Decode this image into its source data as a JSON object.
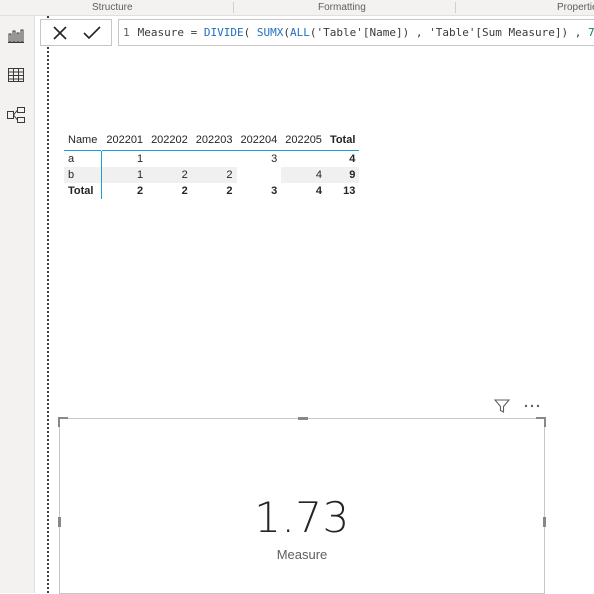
{
  "ribbon": {
    "groups": [
      "Structure",
      "Formatting",
      "Properties"
    ]
  },
  "rail": {
    "items": [
      {
        "icon": "report-view-icon"
      },
      {
        "icon": "data-view-icon"
      },
      {
        "icon": "model-view-icon"
      }
    ]
  },
  "formula_bar": {
    "cancel_icon": "close-icon",
    "commit_icon": "checkmark-icon",
    "line_number": "1",
    "parts": [
      {
        "text": "Measure",
        "kind": "plain"
      },
      {
        "text": " = ",
        "kind": "plain"
      },
      {
        "text": "DIVIDE",
        "kind": "kw"
      },
      {
        "text": "( ",
        "kind": "plain"
      },
      {
        "text": "SUMX",
        "kind": "kw"
      },
      {
        "text": "(",
        "kind": "plain"
      },
      {
        "text": "ALL",
        "kind": "kw"
      },
      {
        "text": "('Table'[Name]) , ",
        "kind": "plain"
      },
      {
        "text": "'Table'[Sum Measure]",
        "kind": "plain"
      },
      {
        "text": ") , ",
        "kind": "plain"
      },
      {
        "text": "7",
        "kind": "num"
      }
    ]
  },
  "matrix": {
    "headers": [
      "Name",
      "202201",
      "202202",
      "202203",
      "202204",
      "202205",
      "Total"
    ],
    "rows": [
      {
        "name": "a",
        "cells": [
          "1",
          "",
          "",
          "3",
          "",
          "4"
        ]
      },
      {
        "name": "b",
        "cells": [
          "1",
          "2",
          "2",
          "",
          "4",
          "9"
        ]
      }
    ],
    "grand_total": {
      "name": "Total",
      "cells": [
        "2",
        "2",
        "2",
        "3",
        "4",
        "13"
      ]
    }
  },
  "card": {
    "value": "1.73",
    "label": "Measure",
    "filter_icon": "filter-icon",
    "more_icon": "more-options-icon"
  },
  "colors": {
    "accent": "#1b9fd6",
    "background": "#ffffff",
    "rail": "#f3f2f1"
  }
}
